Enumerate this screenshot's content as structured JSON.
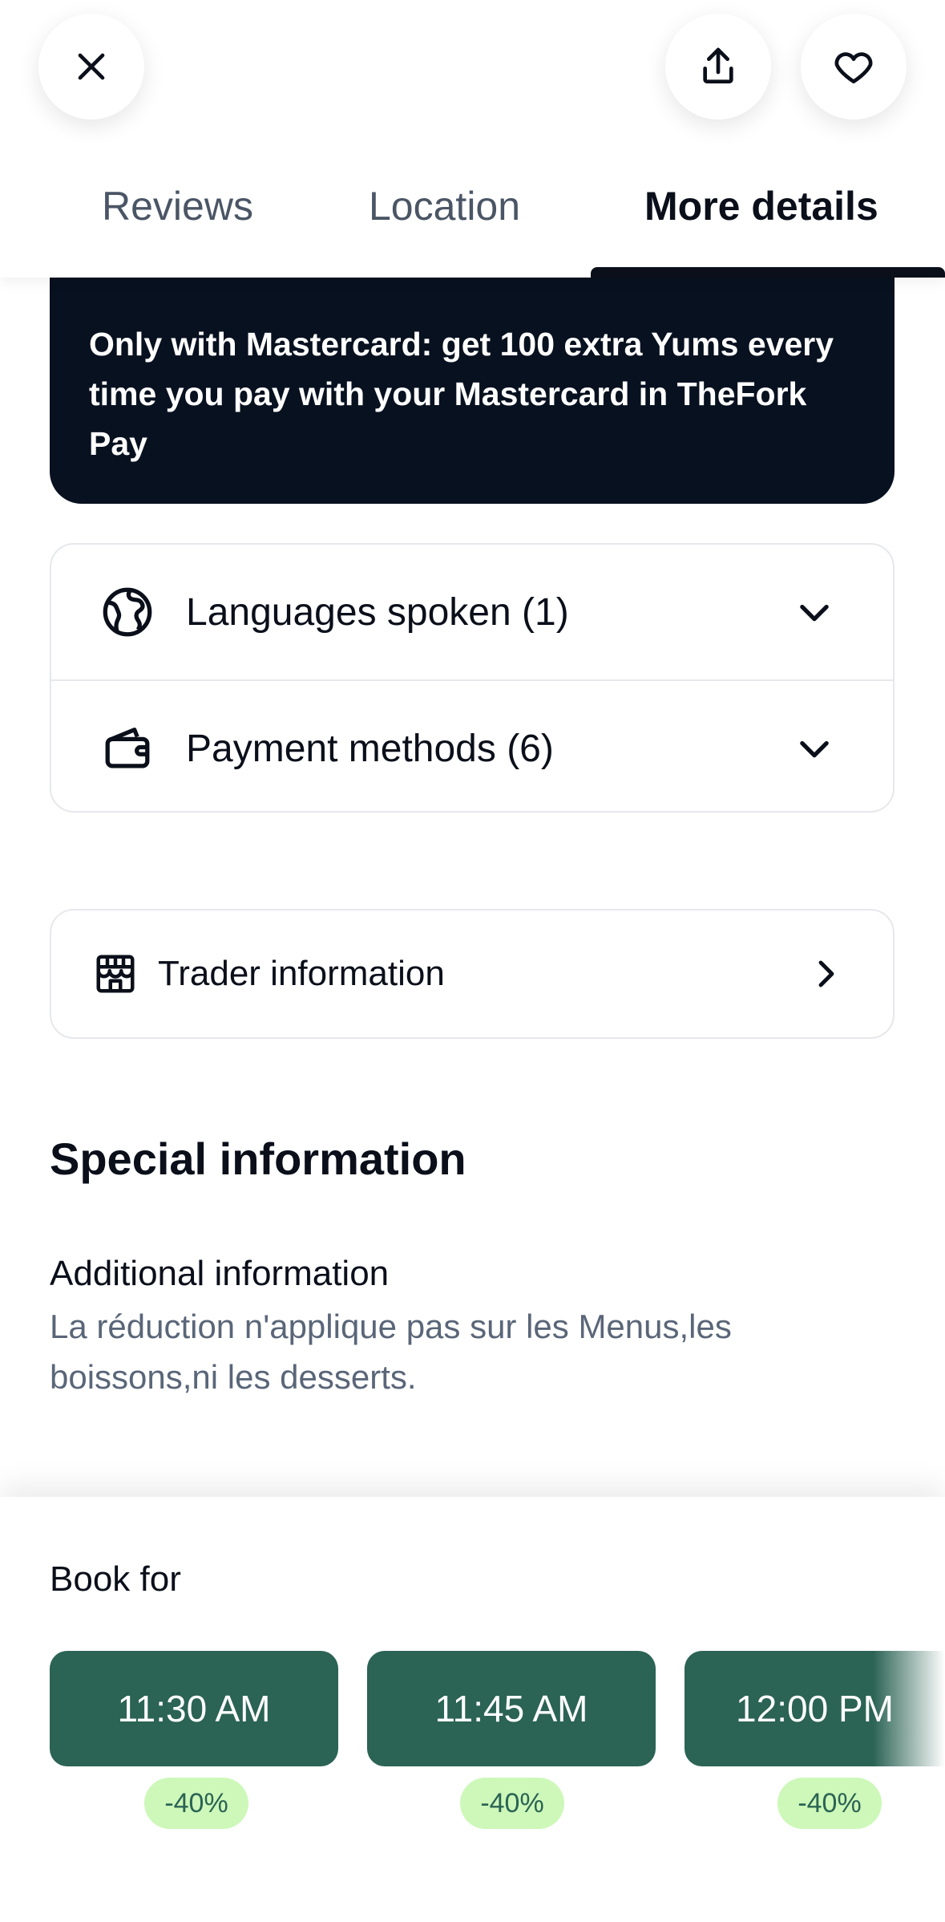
{
  "header": {
    "tabs": [
      {
        "label": "Reviews",
        "active": false
      },
      {
        "label": "Location",
        "active": false
      },
      {
        "label": "More details",
        "active": true
      }
    ],
    "icons": {
      "close": "close-icon",
      "share": "share-icon",
      "favorite": "heart-icon"
    }
  },
  "promo": {
    "text": "Only with Mastercard: get 100 extra Yums every time you pay with your Mastercard in TheFork Pay",
    "background": "#08111f"
  },
  "accordion": [
    {
      "label": "Languages spoken (1)",
      "icon": "globe-icon"
    },
    {
      "label": "Payment methods (6)",
      "icon": "wallet-icon"
    }
  ],
  "trader": {
    "label": "Trader information",
    "icon": "store-icon"
  },
  "special": {
    "title": "Special information",
    "additional_title": "Additional information",
    "additional_text": "La réduction n'applique pas sur les Menus,les boissons,ni les desserts."
  },
  "booking": {
    "label": "Book for",
    "slots": [
      {
        "time": "11:30 AM",
        "discount": "-40%"
      },
      {
        "time": "11:45 AM",
        "discount": "-40%"
      },
      {
        "time": "12:00 PM",
        "discount": "-40%"
      }
    ],
    "colors": {
      "slot": "#2b6354",
      "badge": "#cdf8b9"
    }
  }
}
